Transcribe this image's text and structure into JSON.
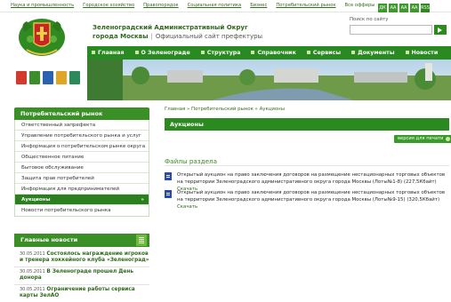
{
  "top_links": [
    "Наука и промышленность",
    "Городское хозяйство",
    "Правопорядок",
    "Социальная политика",
    "Бизнес",
    "Потребительский рынок",
    "Все офферы"
  ],
  "header": {
    "org_line1": "Зеленоградский Административный Округ",
    "org_line2": "города Москвы",
    "subtitle": "Официальный сайт префектуры"
  },
  "search": {
    "label": "Поиск по сайту",
    "value": ""
  },
  "tools": [
    "ДК",
    "АА",
    "АА",
    "АА",
    "RSS"
  ],
  "nav": [
    "Главная",
    "О Зеленограде",
    "Структура",
    "Справочник",
    "Сервисы",
    "Документы",
    "Новости"
  ],
  "sidebar": {
    "title": "Потребительский рынок",
    "items": [
      "Ответственный запрефекта",
      "Управление потребительского рынка и услуг",
      "Информация о потребительском рынке округа",
      "Общественное питание",
      "Бытовое обслуживание",
      "Защита прав потребителей",
      "Информация для предпринимателей",
      "Аукционы",
      "Новости потребительского рынка"
    ],
    "active_index": 7
  },
  "news": {
    "title": "Главные новости",
    "items": [
      {
        "date": "30.05.2011",
        "title": "Состоялось награждение игроков и тренера хоккейного клуба «Зеленоград»"
      },
      {
        "date": "30.05.2011",
        "title": "В Зеленограде прошел День донора"
      },
      {
        "date": "30.05.2011",
        "title": "Ограничение работы сервиса карты ЗелАО"
      }
    ]
  },
  "breadcrumb": "Главная » Потребительский рынок » Аукционы",
  "page_title": "Аукционы",
  "print_label": "версия для печати",
  "files_section": "Файлы раздела",
  "files": [
    {
      "text": "Открытый аукцион на право заключения договоров на размещение нестационарных торговых объектов на территории Зеленоградского административного округа города Москвы (Лоты№1-8)",
      "meta": "(227,5Кбайт)",
      "link": "Скачать"
    },
    {
      "text": "Открытый аукцион на право заключения договоров на размещение нестационарных торговых объектов на территории Зеленоградского административного округа города Москвы (Лоты№9-15)",
      "meta": "(320,5Кбайт)",
      "link": "Скачать"
    }
  ],
  "colors": {
    "brand_green": "#2a8a22",
    "dark_green": "#2f6a1c"
  }
}
